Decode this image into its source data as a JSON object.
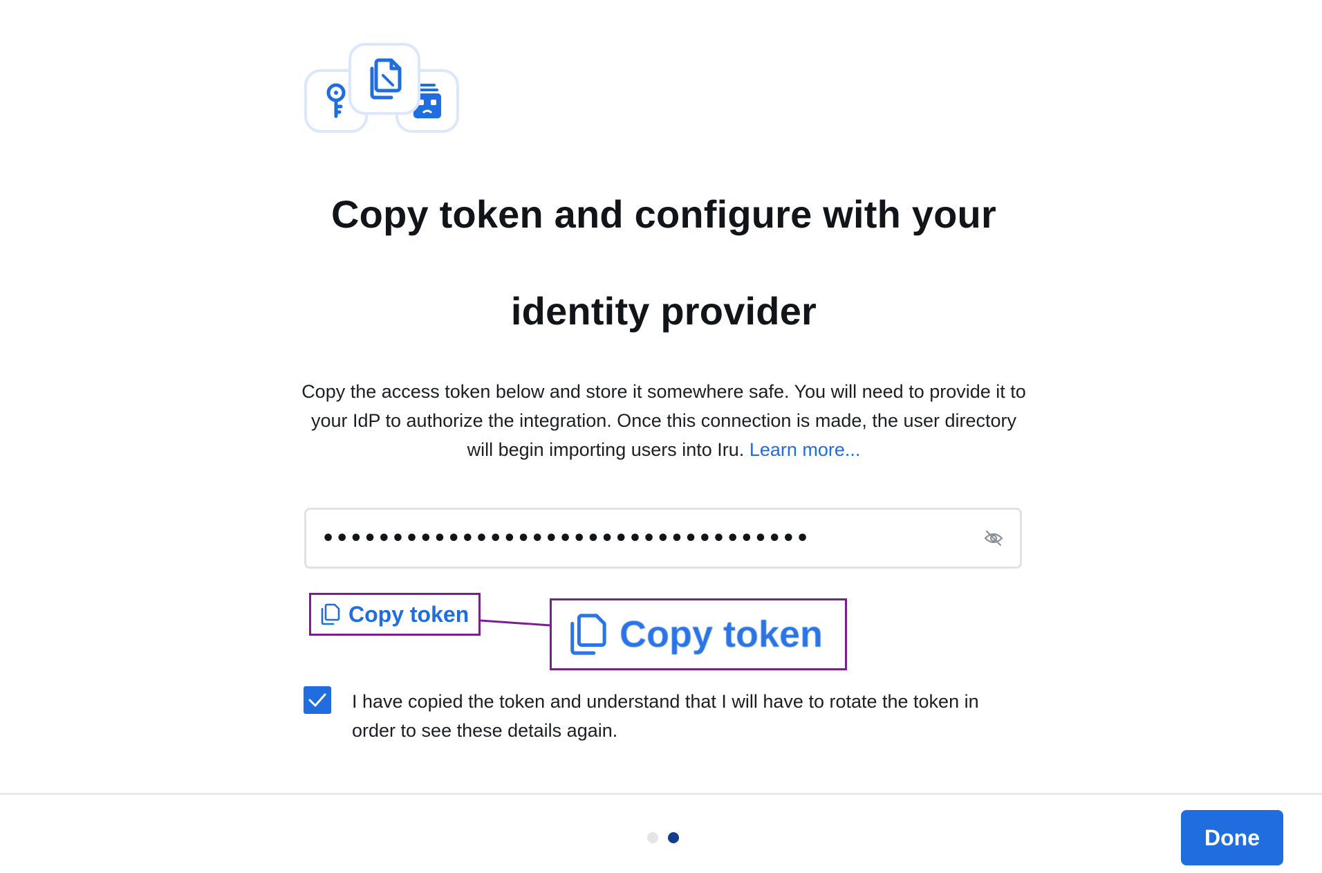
{
  "hero": {
    "icons": [
      "key-icon",
      "copy-icon",
      "id-badge-icon"
    ]
  },
  "heading": {
    "line1": "Copy token and configure with your",
    "line2": "identity provider"
  },
  "description": {
    "text": "Copy the access token below and store it somewhere safe. You will need to provide it to your IdP to authorize the integration. Once this connection is made, the user directory will begin importing users into Iru.",
    "link_text": "Learn more..."
  },
  "token": {
    "masked_value": "•••••••••••••••••••••••••••••••••••",
    "visibility_icon": "eye-slash-icon"
  },
  "copy_token": {
    "label": "Copy token",
    "zoom_label": "Copy token",
    "icon": "copy-icon"
  },
  "acknowledge": {
    "checked": true,
    "label": "I have copied the token and understand that I will have to rotate the token in order to see these details again."
  },
  "footer": {
    "steps_total": 2,
    "current_step": 2,
    "done_label": "Done"
  },
  "colors": {
    "accent": "#1f6ddf",
    "annotation": "#7b1f8f",
    "active_dot": "#123d8f",
    "tile_border": "#dbe8fb"
  }
}
